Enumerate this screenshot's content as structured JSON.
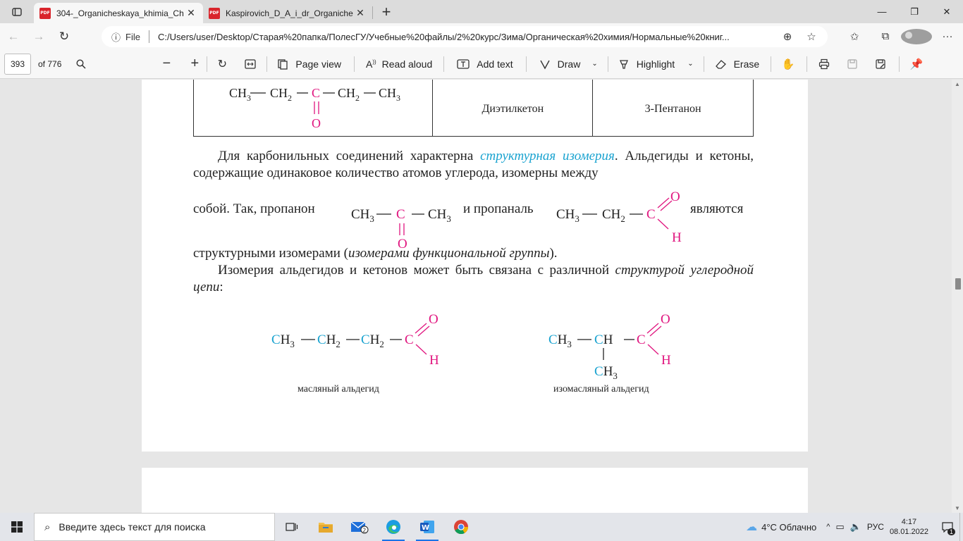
{
  "tabs": [
    {
      "title": "304-_Organicheskaya_khimia_Ch",
      "icon": "pdf-icon",
      "active": true
    },
    {
      "title": "Kaspirovich_D_A_i_dr_Organiche",
      "icon": "pdf-icon",
      "active": false
    }
  ],
  "address": {
    "file_label": "File",
    "url": "C:/Users/user/Desktop/Старая%20папка/ПолесГУ/Учебные%20файлы/2%20курс/Зима/Органическая%20химия/Нормальные%20книг..."
  },
  "pdf_toolbar": {
    "page": "393",
    "of_total": "of 776",
    "page_view": "Page view",
    "read_aloud": "Read aloud",
    "add_text": "Add text",
    "draw": "Draw",
    "highlight": "Highlight",
    "erase": "Erase"
  },
  "document": {
    "table_row": {
      "formula": {
        "ch3": "CH",
        "ch2": "CH",
        "c": "C",
        "o": "O",
        "sub3": "3",
        "sub2": "2"
      },
      "trivial_name": "Диэтилкетон",
      "iupac_name": "3-Пентанон"
    },
    "para1": {
      "before": "Для карбонильных соединений характерна ",
      "term": "структурная изомерия",
      "after": ". Альдегиды и кетоны, содержащие одинаковое количество атомов углерода, изомерны между"
    },
    "para1_line3": {
      "sobo": "собой. Так, пропанон",
      "and": "и пропаналь",
      "are": "являются"
    },
    "para1_line4": {
      "before": "структурными изомерами (",
      "italic": "изомерами функциональной группы",
      "after": ")."
    },
    "para2": {
      "before": "Изомерия альдегидов и кетонов может быть связана с различной ",
      "italic": "структурой углеродной цепи",
      "after": ":"
    },
    "captions": {
      "butanal": "масляный альдегид",
      "isobutanal": "изомасляный альдегид"
    }
  },
  "taskbar": {
    "search_placeholder": "Введите здесь текст для поиска",
    "weather": "4°C  Облачно",
    "lang": "РУС",
    "time": "4:17",
    "date": "08.01.2022",
    "mail_badge": "2",
    "notif_badge": "1"
  },
  "colors": {
    "accent_magenta": "#e0157f",
    "accent_cyan": "#1aa3d0",
    "pdf_red": "#d9252c"
  }
}
